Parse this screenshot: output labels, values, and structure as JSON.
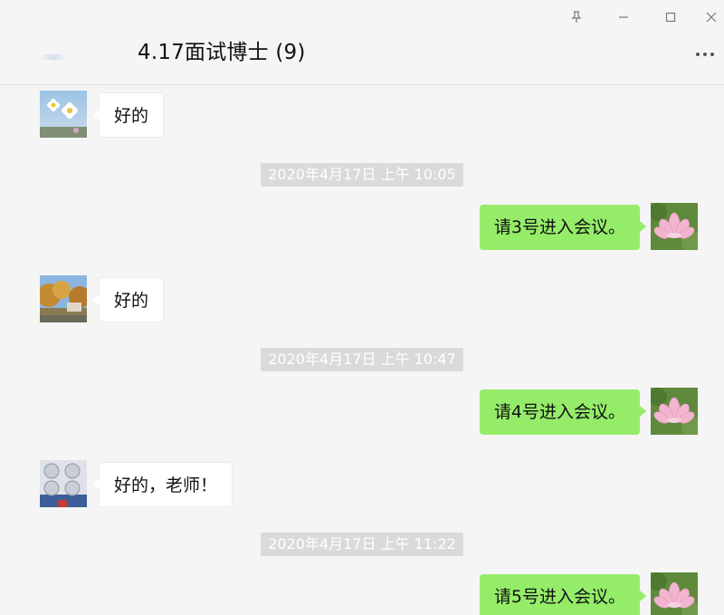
{
  "window": {
    "controls": [
      "pin-icon",
      "minimize-icon",
      "maximize-icon",
      "close-icon"
    ]
  },
  "header": {
    "title": "4.17面试博士 (9)",
    "more_icon": "more-dots-icon"
  },
  "messages": [
    {
      "side": "left",
      "text": "好的",
      "avatar": "white-cosmos-flowers"
    },
    {
      "timestamp": "2020年4月17日 上午 10:05"
    },
    {
      "side": "right",
      "text": "请3号进入会议。",
      "avatar": "pink-lotus"
    },
    {
      "side": "left",
      "text": "好的",
      "avatar": "autumn-campus-photo"
    },
    {
      "timestamp": "2020年4月17日 上午 10:47"
    },
    {
      "side": "right",
      "text": "请4号进入会议。",
      "avatar": "pink-lotus"
    },
    {
      "side": "left",
      "text": "好的，老师！",
      "avatar": "good-letters-photo"
    },
    {
      "timestamp": "2020年4月17日 上午 11:22"
    },
    {
      "side": "right",
      "text": "请5号进入会议。",
      "avatar": "pink-lotus"
    }
  ],
  "colors": {
    "background": "#f5f5f5",
    "sent_bubble": "#95ec69",
    "received_bubble": "#ffffff",
    "timestamp_bg": "#dadada"
  }
}
